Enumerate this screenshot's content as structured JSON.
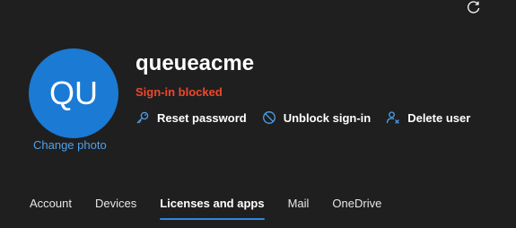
{
  "header": {
    "refresh_icon": "refresh-icon"
  },
  "user": {
    "initials": "QU",
    "change_photo_label": "Change photo",
    "display_name": "queueacme",
    "status": "Sign-in blocked"
  },
  "actions": [
    {
      "label": "Reset password",
      "icon": "key-icon"
    },
    {
      "label": "Unblock sign-in",
      "icon": "block-icon"
    },
    {
      "label": "Delete user",
      "icon": "delete-user-icon"
    }
  ],
  "tabs": [
    {
      "label": "Account"
    },
    {
      "label": "Devices"
    },
    {
      "label": "Licenses and apps",
      "active": true
    },
    {
      "label": "Mail"
    },
    {
      "label": "OneDrive"
    }
  ],
  "colors": {
    "background": "#1f1f1f",
    "avatar": "#1b7ad3",
    "link": "#4ea1ec",
    "status_error": "#f1472b",
    "tab_underline": "#2e86de"
  }
}
